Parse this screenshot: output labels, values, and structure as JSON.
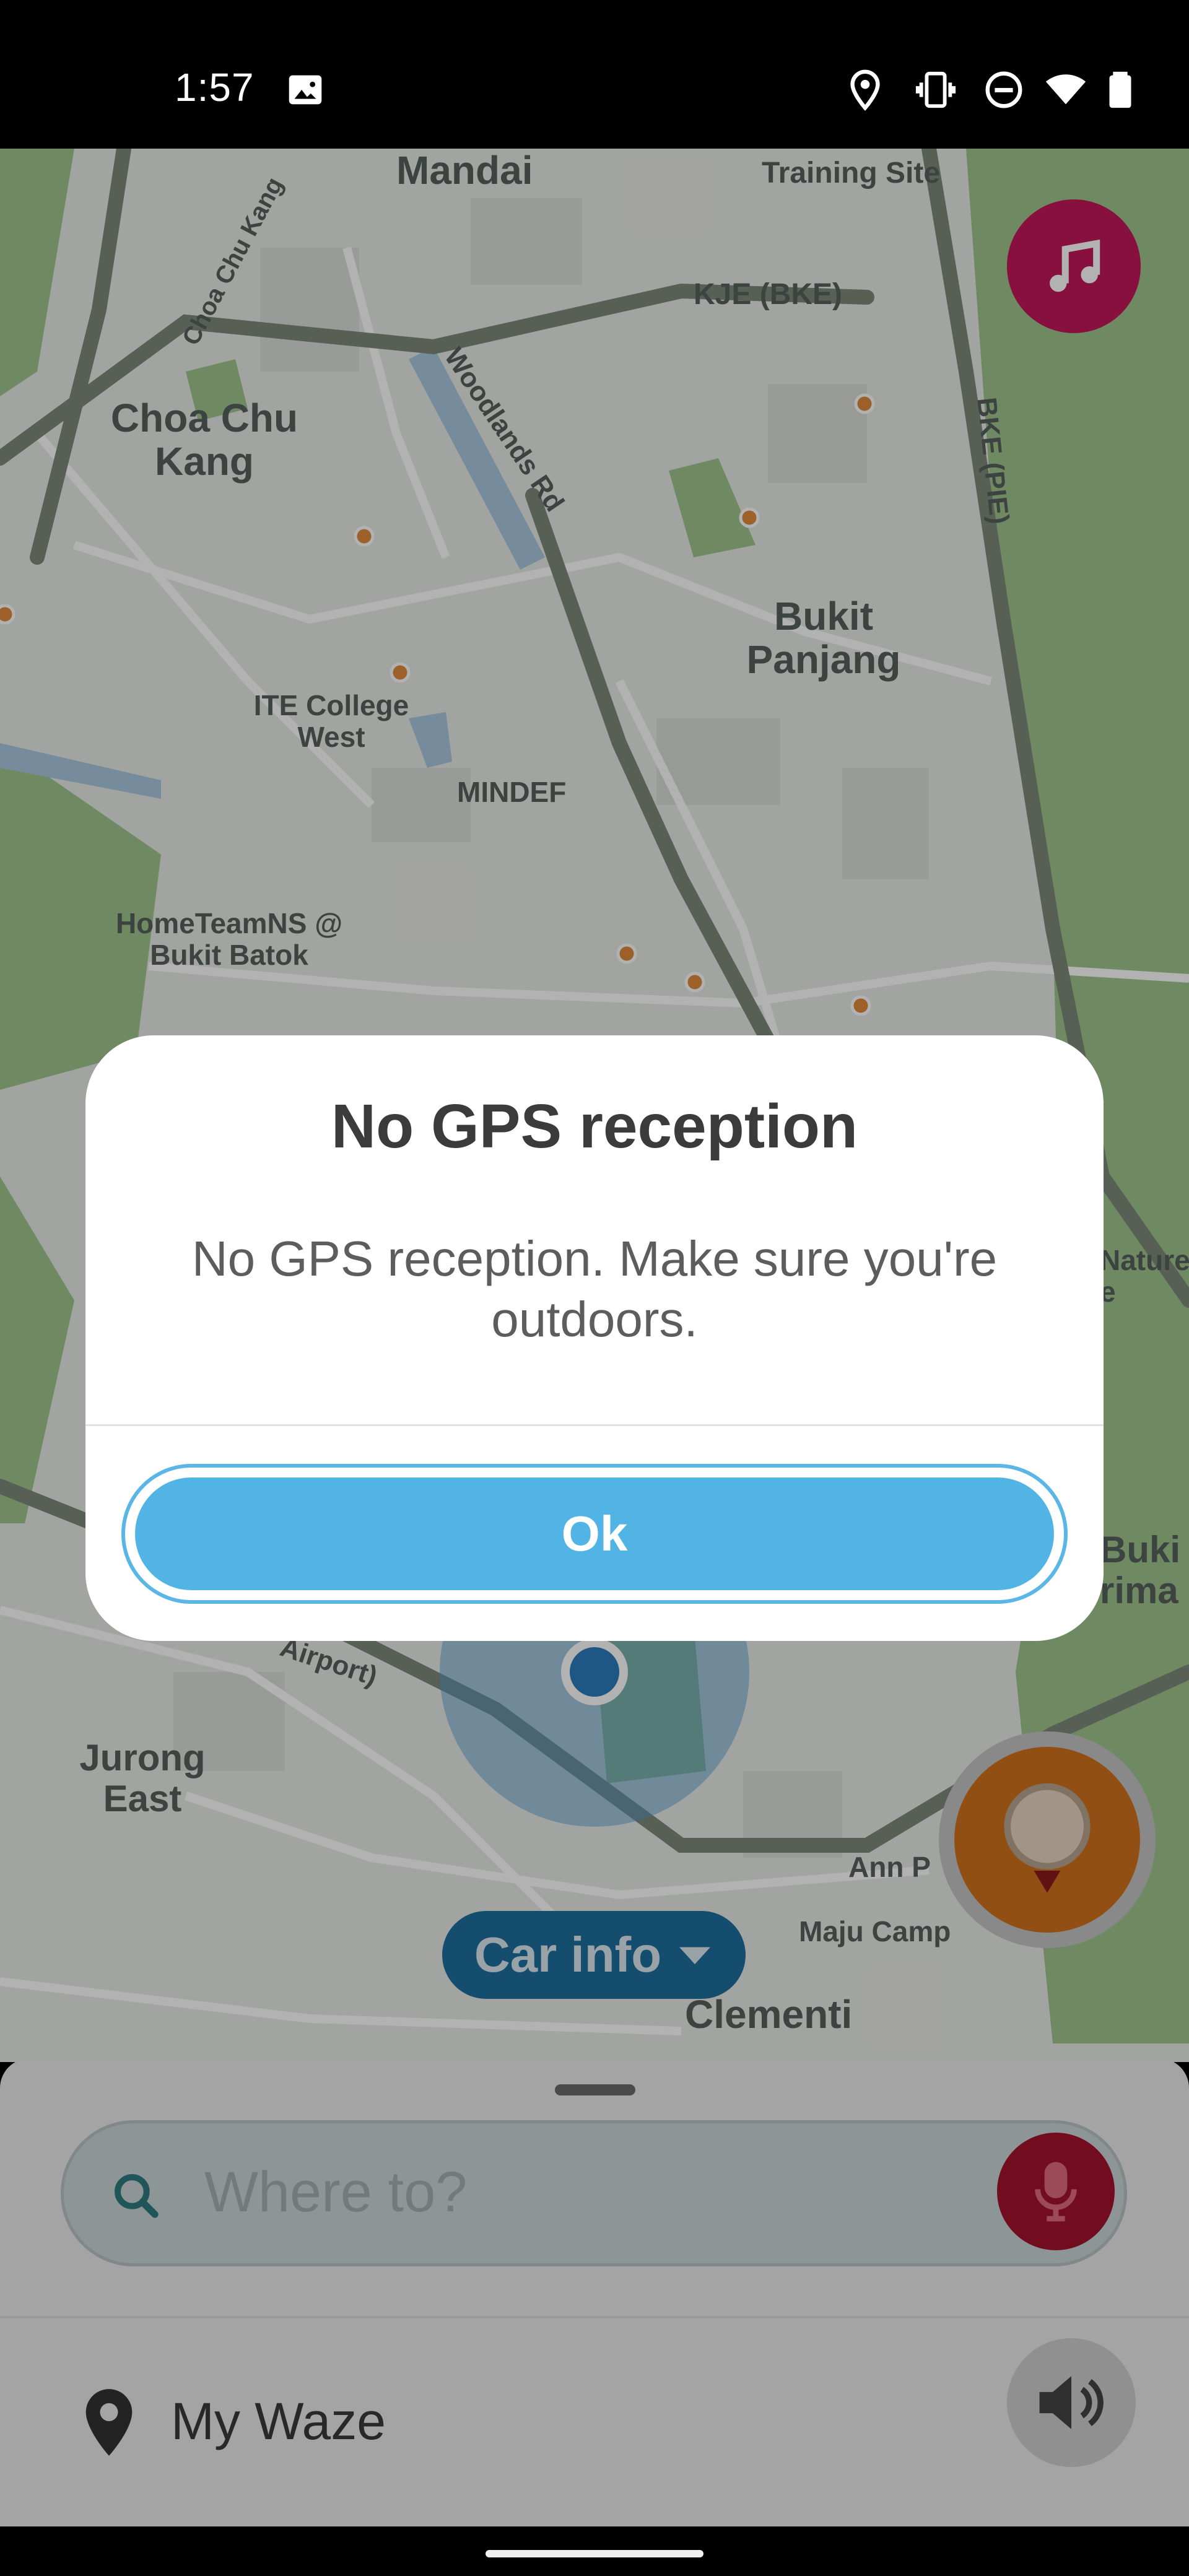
{
  "status_bar": {
    "time": "1:57",
    "icons": [
      "image-icon",
      "location-icon",
      "vibrate-icon",
      "dnd-icon",
      "wifi-icon",
      "battery-icon"
    ]
  },
  "map": {
    "labels": [
      "Mandai",
      "Training Site",
      "KJE (BKE)",
      "Choa Chu Kang",
      "Woodlands Rd",
      "BKE (PIE)",
      "Choa Chu Kang",
      "Bukit Panjang",
      "ITE College West",
      "MINDEF",
      "HomeTeamNS @ Bukit Batok",
      "Jurong East",
      "Airport)",
      "Ann P",
      "Maju Camp",
      "Clementi",
      "Nature e",
      "Buki rima"
    ]
  },
  "music_button": {
    "icon": "music-note-icon",
    "color": "#c2185b"
  },
  "car_info": {
    "label": "Car info",
    "icon": "chevron-down-icon"
  },
  "report_button": {
    "icon": "report-icon",
    "color": "#d2711d"
  },
  "dialog": {
    "title": "No GPS reception",
    "message": "No GPS reception. Make sure you're outdoors.",
    "ok_label": "Ok"
  },
  "bottom_sheet": {
    "search_placeholder": "Where to?",
    "my_waze_label": "My Waze"
  },
  "colors": {
    "accent": "#52b4e4",
    "mic": "#a3142b"
  }
}
